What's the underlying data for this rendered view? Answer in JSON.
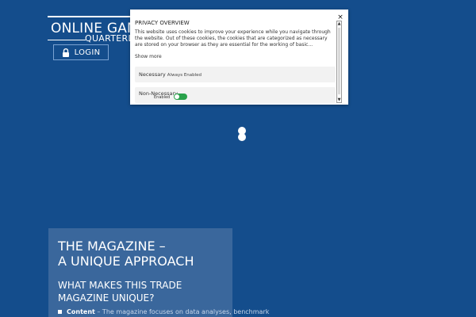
{
  "header": {
    "logo_main": "ONLINE GAMI",
    "logo_sub": "QUARTERLY",
    "login_label": "LOGIN",
    "login_icon": "lock-icon"
  },
  "cookie_modal": {
    "title": "PRIVACY OVERVIEW",
    "text": "This website uses cookies to improve your experience while you navigate through the website. Out of these cookies, the cookies that are categorized as necessary are stored on your browser as they are essential for the working of basic...",
    "show_more": "Show more",
    "close_symbol": "×",
    "categories": [
      {
        "name": "Necessary",
        "note": "Always Enabled"
      },
      {
        "name": "Non-Necessary",
        "toggle_label": "Enabled",
        "enabled": true
      }
    ],
    "scroll_up_symbol": "▲",
    "scroll_down_symbol": "▼"
  },
  "magazine": {
    "title": "THE MAGAZINE –\nA UNIQUE APPROACH",
    "subtitle": "WHAT MAKES THIS TRADE MAGAZINE UNIQUE?",
    "items": [
      {
        "label": "Content",
        "text": " – The magazine focuses on data analyses, benchmark"
      }
    ]
  },
  "colors": {
    "background": "#144d8c",
    "panel": "#3a679c",
    "toggle_on": "#2aa24b"
  }
}
